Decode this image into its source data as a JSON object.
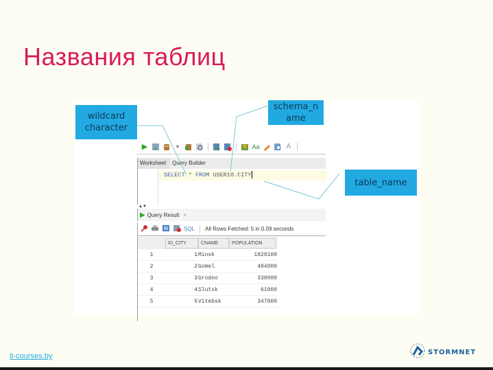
{
  "slide": {
    "title": "Названия таблиц",
    "footer_link": "it-courses.by",
    "logo_text": "STORMNET"
  },
  "callouts": {
    "wildcard": "wildcard character",
    "schema": "schema_n ame",
    "table": "table_name"
  },
  "ide": {
    "toolbar_icons": [
      "run-statement-icon",
      "run-script-icon",
      "commit-icon",
      "dropdown-icon",
      "rollback-icon",
      "explain-plan-icon",
      "autotrace-icon",
      "sql-tuning-icon",
      "clear-icon",
      "history-icon",
      "format-icon",
      "find-icon",
      "more-icon"
    ],
    "tabs": {
      "worksheet": "Worksheet",
      "query_builder": "Query Builder"
    },
    "query": {
      "select": "SELECT",
      "star": "*",
      "from": "FROM",
      "object": "USER10.CITY"
    },
    "result_tab": {
      "label": "Query Result",
      "close": "×"
    },
    "result_toolbar": {
      "sql_label": "SQL",
      "status": "All Rows Fetched: 5 in 0.09 seconds"
    },
    "grid": {
      "columns": [
        "ID_CITY",
        "CNAME",
        "POPULATION"
      ],
      "rows": [
        {
          "n": "1",
          "id": "1",
          "name": "Minsk",
          "population": "1829100"
        },
        {
          "n": "2",
          "id": "2",
          "name": "Gomel",
          "population": "484000"
        },
        {
          "n": "3",
          "id": "3",
          "name": "Grodno",
          "population": "338000"
        },
        {
          "n": "4",
          "id": "4",
          "name": "Slutsk",
          "population": "61000"
        },
        {
          "n": "5",
          "id": "5",
          "name": "Vitebsk",
          "population": "347000"
        }
      ]
    }
  },
  "colors": {
    "title": "#d81b5a",
    "callout_bg": "#22a9e2",
    "callout_text": "#0d3a56",
    "link": "#22a9e2",
    "connector_line": "#7fc4d8"
  }
}
